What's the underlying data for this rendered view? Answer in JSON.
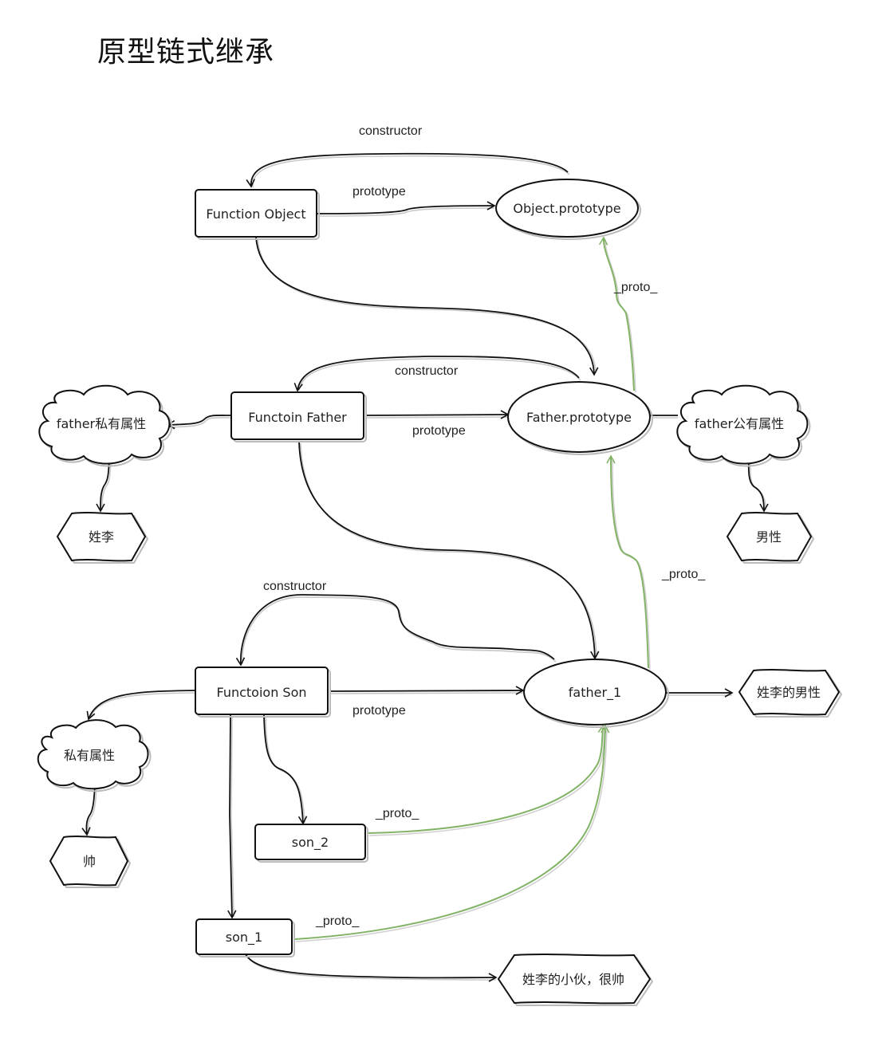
{
  "title": "原型链式继承",
  "colors": {
    "stroke": "#111111",
    "proto_edge": "#82b366",
    "background": "#ffffff"
  },
  "nodes": {
    "function_object": {
      "label": "Function Object",
      "shape": "rectangle"
    },
    "object_prototype": {
      "label": "Object.prototype",
      "shape": "ellipse"
    },
    "function_father": {
      "label": "Functoin Father",
      "shape": "rectangle"
    },
    "father_prototype": {
      "label": "Father.prototype",
      "shape": "ellipse"
    },
    "father_private": {
      "label": "father私有属性",
      "shape": "cloud"
    },
    "father_public": {
      "label": "father公有属性",
      "shape": "cloud"
    },
    "surname_li": {
      "label": "姓李",
      "shape": "hexagon-cloud"
    },
    "male": {
      "label": "男性",
      "shape": "hexagon-cloud"
    },
    "function_son": {
      "label": "Functoion Son",
      "shape": "rectangle"
    },
    "father_1": {
      "label": "father_1",
      "shape": "ellipse"
    },
    "li_male": {
      "label": "姓李的男性",
      "shape": "hexagon-cloud"
    },
    "son_private": {
      "label": "私有属性",
      "shape": "cloud"
    },
    "handsome": {
      "label": "帅",
      "shape": "hexagon-cloud"
    },
    "son_2": {
      "label": "son_2",
      "shape": "rectangle"
    },
    "son_1": {
      "label": "son_1",
      "shape": "rectangle"
    },
    "li_guy": {
      "label": "姓李的小伙，很帅",
      "shape": "hexagon-cloud"
    }
  },
  "edge_labels": {
    "obj_constructor": "constructor",
    "obj_prototype": "prototype",
    "father_proto_to_obj": "_proto_",
    "father_constructor": "constructor",
    "father_prototype": "prototype",
    "father1_proto_to_fp": "_proto_",
    "son_constructor": "constructor",
    "son_prototype": "prototype",
    "son2_proto": "_proto_",
    "son1_proto": "_proto_"
  }
}
